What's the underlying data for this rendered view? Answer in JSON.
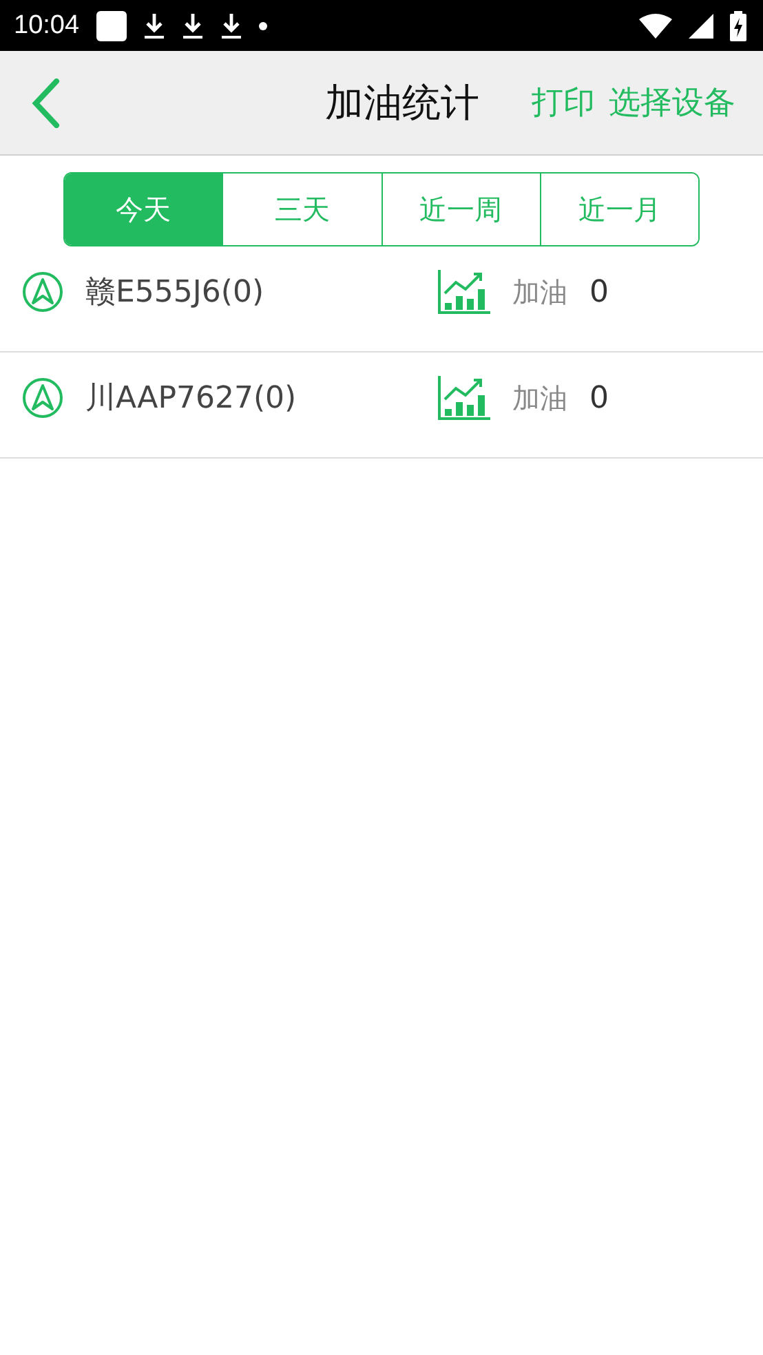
{
  "status_bar": {
    "time": "10:04"
  },
  "header": {
    "title": "加油统计",
    "actions": [
      "打印",
      "选择设备"
    ]
  },
  "tabs": [
    {
      "label": "今天",
      "selected": true
    },
    {
      "label": "三天",
      "selected": false
    },
    {
      "label": "近一周",
      "selected": false
    },
    {
      "label": "近一月",
      "selected": false
    }
  ],
  "vehicles": [
    {
      "name": "赣E555J6(0)",
      "label": "加油",
      "value": "0"
    },
    {
      "name": "川AAP7627(0)",
      "label": "加油",
      "value": "0"
    }
  ]
}
